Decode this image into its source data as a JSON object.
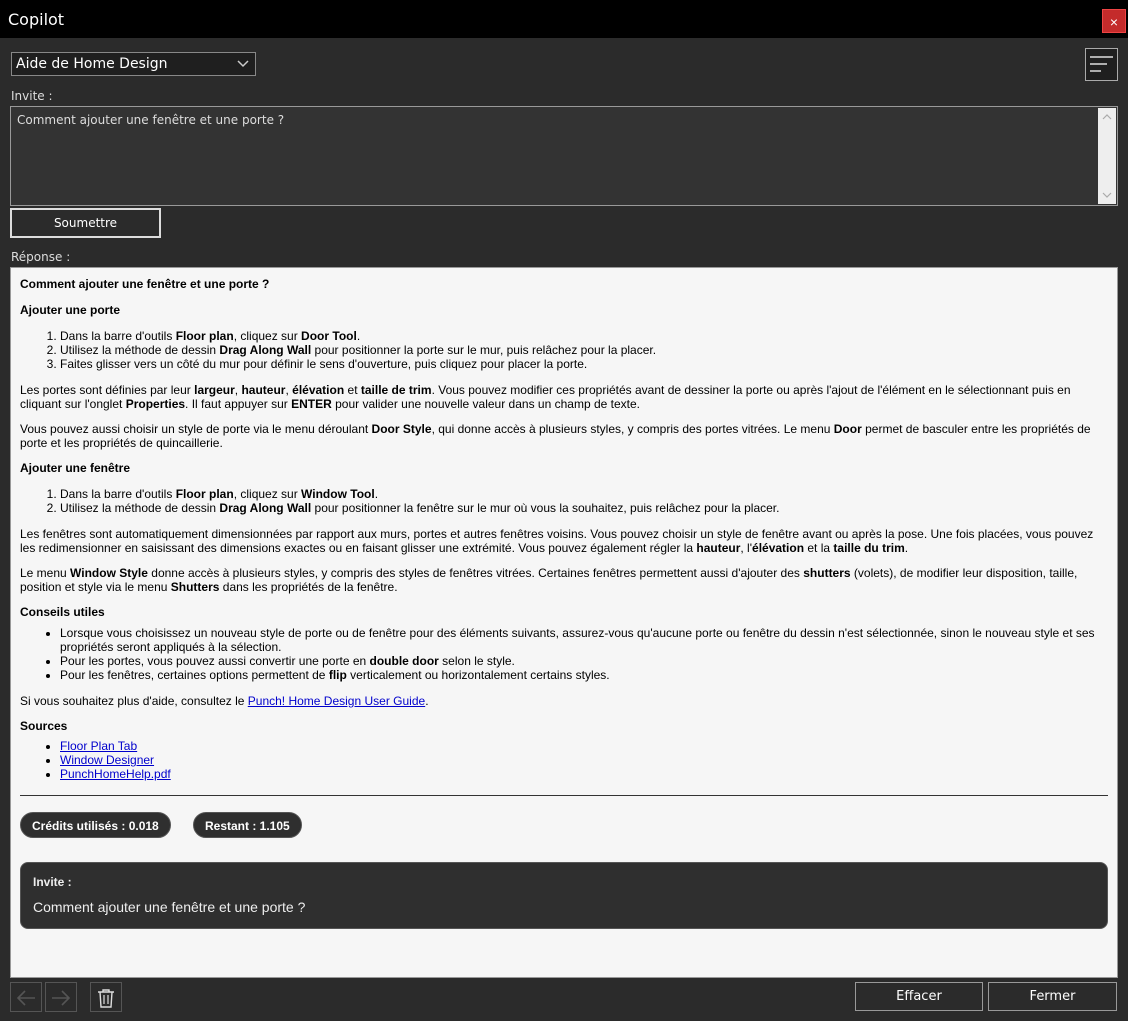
{
  "window": {
    "title": "Copilot",
    "close_glyph": "×"
  },
  "selector": {
    "value": "Aide de Home Design"
  },
  "prompt": {
    "label": "Invite :",
    "value": "Comment ajouter une fenêtre et une porte ?"
  },
  "submit_label": "Soumettre",
  "response": {
    "label": "Réponse :",
    "question": "Comment ajouter une fenêtre et une porte ?",
    "door": {
      "heading": "Ajouter une porte",
      "steps": [
        [
          "Dans la barre d'outils ",
          "Floor plan",
          ", cliquez sur ",
          "Door Tool",
          "."
        ],
        [
          "Utilisez la méthode de dessin ",
          "Drag Along Wall",
          " pour positionner la porte sur le mur, puis relâchez pour la placer."
        ],
        [
          "Faites glisser vers un côté du mur pour définir le sens d'ouverture, puis cliquez pour placer la porte."
        ]
      ],
      "para1": [
        "Les portes sont définies par leur ",
        "largeur",
        ", ",
        "hauteur",
        ", ",
        "élévation",
        " et ",
        "taille de trim",
        ". Vous pouvez modifier ces propriétés avant de dessiner la porte ou après l'ajout de l'élément en le sélectionnant puis en cliquant sur l'onglet ",
        "Properties",
        ". Il faut appuyer sur ",
        "ENTER",
        " pour valider une nouvelle valeur dans un champ de texte."
      ],
      "para2": [
        "Vous pouvez aussi choisir un style de porte via le menu déroulant ",
        "Door Style",
        ", qui donne accès à plusieurs styles, y compris des portes vitrées. Le menu ",
        "Door",
        " permet de basculer entre les propriétés de porte et les propriétés de quincaillerie."
      ]
    },
    "window_section": {
      "heading": "Ajouter une fenêtre",
      "steps": [
        [
          "Dans la barre d'outils ",
          "Floor plan",
          ", cliquez sur ",
          "Window Tool",
          "."
        ],
        [
          "Utilisez la méthode de dessin ",
          "Drag Along Wall",
          " pour positionner la fenêtre sur le mur où vous la souhaitez, puis relâchez pour la placer."
        ]
      ],
      "para1": [
        "Les fenêtres sont automatiquement dimensionnées par rapport aux murs, portes et autres fenêtres voisins. Vous pouvez choisir un style de fenêtre avant ou après la pose. Une fois placées, vous pouvez les redimensionner en saisissant des dimensions exactes ou en faisant glisser une extrémité. Vous pouvez également régler la ",
        "hauteur",
        ", l'",
        "élévation",
        " et la ",
        "taille du trim",
        "."
      ],
      "para2": [
        "Le menu ",
        "Window Style",
        " donne accès à plusieurs styles, y compris des styles de fenêtres vitrées. Certaines fenêtres permettent aussi d'ajouter des ",
        "shutters",
        " (volets), de modifier leur disposition, taille, position et style via le menu ",
        "Shutters",
        " dans les propriétés de la fenêtre."
      ]
    },
    "tips": {
      "heading": "Conseils utiles",
      "items": [
        [
          "Lorsque vous choisissez un nouveau style de porte ou de fenêtre pour des éléments suivants, assurez-vous qu'aucune porte ou fenêtre du dessin n'est sélectionnée, sinon le nouveau style et ses propriétés seront appliqués à la sélection."
        ],
        [
          "Pour les portes, vous pouvez aussi convertir une porte en ",
          "double door",
          " selon le style."
        ],
        [
          "Pour les fenêtres, certaines options permettent de ",
          "flip",
          " verticalement ou horizontalement certains styles."
        ]
      ]
    },
    "help_prefix": "Si vous souhaitez plus d'aide, consultez le ",
    "help_link": "Punch! Home Design User Guide",
    "help_suffix": ".",
    "sources": {
      "heading": "Sources",
      "links": [
        "Floor Plan Tab",
        "Window Designer",
        "PunchHomeHelp.pdf"
      ]
    },
    "credits_used": "Crédits utilisés : 0.018",
    "credits_left": "Restant : 1.105",
    "card_label": "Invite :",
    "card_text": "Comment ajouter une fenêtre et une porte ?"
  },
  "buttons": {
    "clear": "Effacer",
    "close": "Fermer"
  },
  "colors": {
    "close_red": "#c42b2b",
    "link": "#0000cc",
    "pill_bg": "#2f2f2f"
  }
}
